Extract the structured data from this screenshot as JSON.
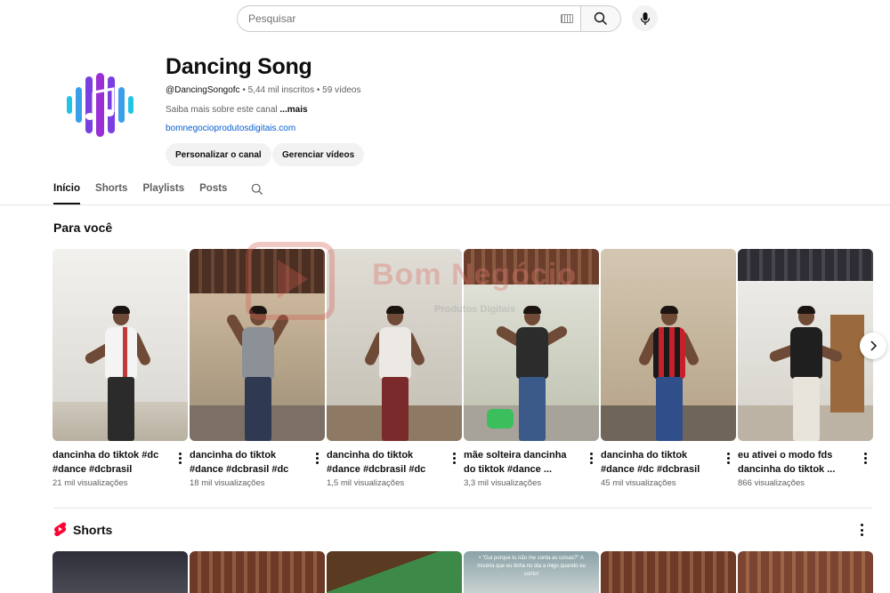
{
  "search": {
    "placeholder": "Pesquisar"
  },
  "channel": {
    "name": "Dancing Song",
    "handle": "@DancingSongofc",
    "meta": " • 5,44 mil inscritos • 59 vídeos",
    "description": "Saiba mais sobre este canal ",
    "more": "...mais",
    "link": "bomnegocioprodutosdigitais.com",
    "customize_label": "Personalizar o canal",
    "manage_label": "Gerenciar vídeos"
  },
  "tabs": [
    {
      "label": "Início"
    },
    {
      "label": "Shorts"
    },
    {
      "label": "Playlists"
    },
    {
      "label": "Posts"
    }
  ],
  "for_you": {
    "title": "Para você",
    "videos": [
      {
        "title": "dancinha do tiktok #dc #dance #dcbrasil",
        "views": "21 mil visualizações"
      },
      {
        "title": "dancinha do tiktok #dance #dcbrasil #dc",
        "views": "18 mil visualizações"
      },
      {
        "title": "dancinha do tiktok #dance #dcbrasil #dc",
        "views": "1,5 mil visualizações"
      },
      {
        "title": "mãe solteira dancinha do tiktok #dance ...",
        "views": "3,3 mil visualizações"
      },
      {
        "title": "dancinha do tiktok #dance #dc #dcbrasil",
        "views": "45 mil visualizações"
      },
      {
        "title": "eu ativei o modo fds dancinha do tiktok ...",
        "views": "866 visualizações"
      }
    ]
  },
  "watermark": {
    "brand": "Bom Negócio",
    "sub": "Produtos Digitais"
  },
  "shorts": {
    "title": "Shorts",
    "captions": [
      "",
      "",
      "",
      "• \"Gui porque tu não me conta as coisas?\" A miséria que eu tinha no dia a migo quando eu conto!",
      "",
      ""
    ]
  },
  "colors": {
    "link": "#065fd4",
    "shorts_red": "#ff0033",
    "logo_purple": "#9b2fd6",
    "logo_cyan": "#22c4e6"
  }
}
